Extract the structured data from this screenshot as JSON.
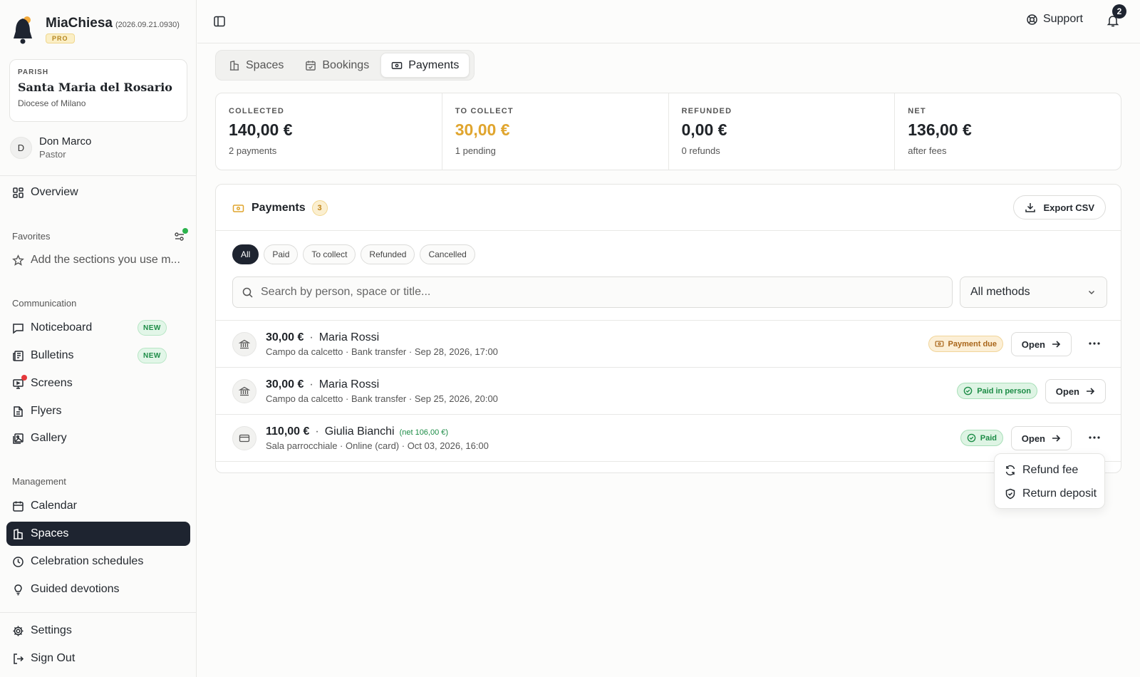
{
  "app": {
    "name": "MiaChiesa",
    "version": "(2026.09.21.0930)",
    "plan": "PRO"
  },
  "parish": {
    "label": "PARISH",
    "name": "Santa Maria del Rosario",
    "diocese": "Diocese of Milano"
  },
  "user": {
    "initial": "D",
    "name": "Don Marco",
    "role": "Pastor"
  },
  "sidebar": {
    "overview": "Overview",
    "favorites_label": "Favorites",
    "favorites_empty": "Add the sections you use m...",
    "communication_label": "Communication",
    "communication": [
      {
        "label": "Noticeboard",
        "badge": "NEW"
      },
      {
        "label": "Bulletins",
        "badge": "NEW"
      },
      {
        "label": "Screens"
      },
      {
        "label": "Flyers"
      },
      {
        "label": "Gallery"
      }
    ],
    "management_label": "Management",
    "management": [
      {
        "label": "Calendar"
      },
      {
        "label": "Spaces"
      },
      {
        "label": "Celebration schedules"
      },
      {
        "label": "Guided devotions"
      }
    ],
    "settings": "Settings",
    "signout": "Sign Out"
  },
  "topbar": {
    "support": "Support",
    "notifications": "2"
  },
  "tabs": [
    {
      "label": "Spaces"
    },
    {
      "label": "Bookings"
    },
    {
      "label": "Payments"
    }
  ],
  "stats": [
    {
      "label": "COLLECTED",
      "value": "140,00 €",
      "sub": "2 payments"
    },
    {
      "label": "TO COLLECT",
      "value": "30,00 €",
      "sub": "1 pending"
    },
    {
      "label": "REFUNDED",
      "value": "0,00 €",
      "sub": "0 refunds"
    },
    {
      "label": "NET",
      "value": "136,00 €",
      "sub": "after fees"
    }
  ],
  "payments": {
    "title": "Payments",
    "count": "3",
    "export": "Export CSV",
    "filters": [
      "All",
      "Paid",
      "To collect",
      "Refunded",
      "Cancelled"
    ],
    "search_placeholder": "Search by person, space or title...",
    "method": "All methods",
    "rows": [
      {
        "amount": "30,00 €",
        "sep": "·",
        "person": "Maria Rossi",
        "net": "",
        "details": "Campo da calcetto · Bank transfer · Sep 28, 2026, 17:00",
        "status": "Payment due",
        "open": "Open"
      },
      {
        "amount": "30,00 €",
        "sep": "·",
        "person": "Maria Rossi",
        "net": "",
        "details": "Campo da calcetto · Bank transfer · Sep 25, 2026, 20:00",
        "status": "Paid in person",
        "open": "Open"
      },
      {
        "amount": "110,00 €",
        "sep": "·",
        "person": "Giulia Bianchi",
        "net": "(net 106,00 €)",
        "details": "Sala parrocchiale · Online (card) · Oct 03, 2026, 16:00",
        "status": "Paid",
        "open": "Open"
      }
    ]
  },
  "menu": {
    "refund_fee": "Refund fee",
    "return_deposit": "Return deposit"
  },
  "colors": {
    "accent_dark": "#1e2430",
    "warning": "#e0a52e",
    "success": "#1c8c46"
  }
}
